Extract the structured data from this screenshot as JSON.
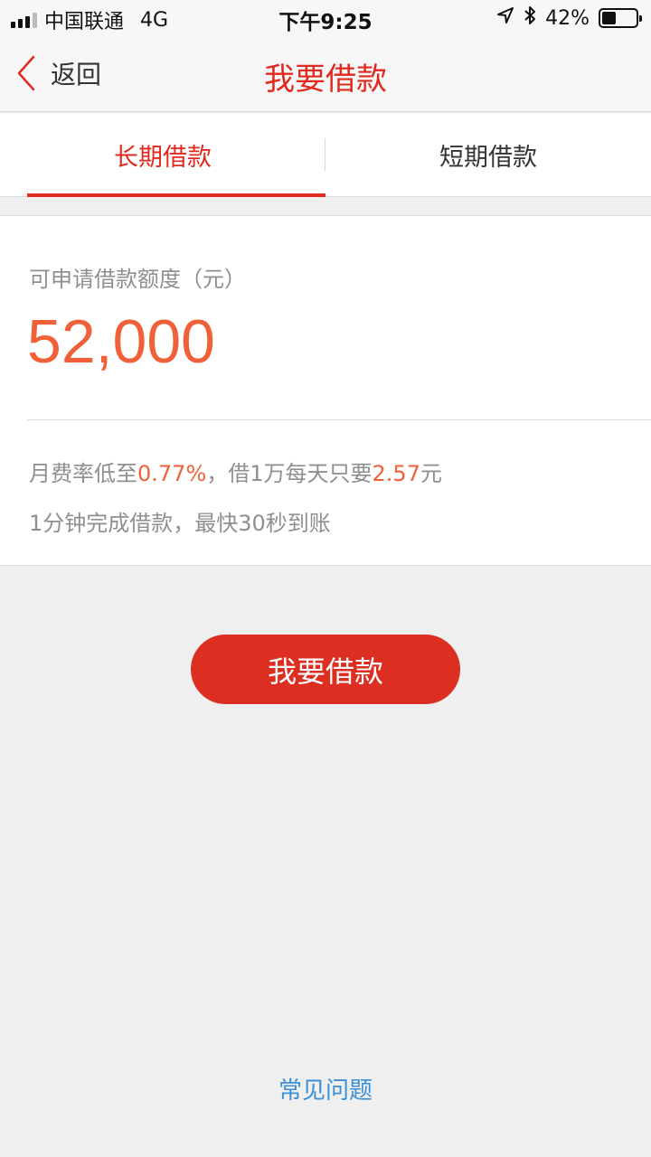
{
  "status_bar": {
    "carrier": "中国联通",
    "network": "4G",
    "time": "下午9:25",
    "battery_percent": "42%",
    "battery_level": 0.42,
    "icons": [
      "signal-icon",
      "location-arrow-icon",
      "bluetooth-icon",
      "battery-icon"
    ]
  },
  "nav": {
    "back_label": "返回",
    "title": "我要借款"
  },
  "tabs": [
    {
      "label": "长期借款",
      "active": true
    },
    {
      "label": "短期借款",
      "active": false
    }
  ],
  "credit": {
    "label": "可申请借款额度（元）",
    "amount": "52,000"
  },
  "info": {
    "line1_prefix": "月费率低至",
    "line1_rate": "0.77%",
    "line1_middle": "，借1万每天只要",
    "line1_daily": "2.57",
    "line1_suffix": "元",
    "line2": "1分钟完成借款，最快30秒到账"
  },
  "actions": {
    "borrow_label": "我要借款",
    "faq_label": "常见问题"
  },
  "colors": {
    "accent_red": "#e12a1f",
    "button_red": "#dd2e22",
    "amount_orange": "#f0613a",
    "link_blue": "#3d8fd6",
    "background": "#efeff0"
  }
}
